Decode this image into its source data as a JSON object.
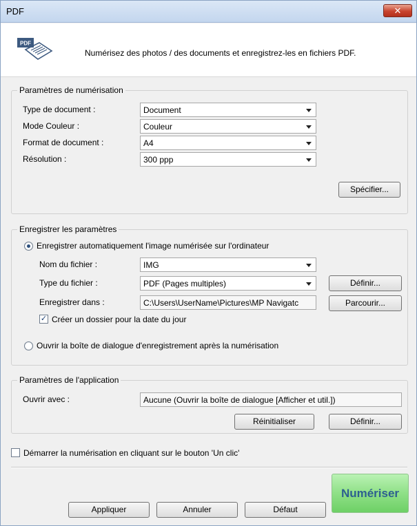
{
  "window": {
    "title": "PDF",
    "close_glyph": "✕"
  },
  "header": {
    "description": "Numérisez des photos / des documents et enregistrez-les en fichiers PDF.",
    "icon": "pdf-document-icon"
  },
  "scan_settings": {
    "legend": "Paramètres de numérisation",
    "doc_type_label": "Type de document :",
    "doc_type_value": "Document",
    "color_mode_label": "Mode Couleur :",
    "color_mode_value": "Couleur",
    "doc_size_label": "Format de document :",
    "doc_size_value": "A4",
    "resolution_label": "Résolution :",
    "resolution_value": "300 ppp",
    "specify_button": "Spécifier..."
  },
  "save_settings": {
    "legend": "Enregistrer les paramètres",
    "auto_save_label": "Enregistrer automatiquement l'image numérisée sur l'ordinateur",
    "auto_save_selected": true,
    "file_name_label": "Nom du fichier :",
    "file_name_value": "IMG",
    "file_type_label": "Type du fichier :",
    "file_type_value": "PDF (Pages multiples)",
    "define_button": "Définir...",
    "save_in_label": "Enregistrer dans :",
    "save_in_value": "C:\\Users\\UserName\\Pictures\\MP Navigatc",
    "browse_button": "Parcourir...",
    "subfolder_label": "Créer un dossier pour la date du jour",
    "subfolder_checked": true,
    "open_dialog_label": "Ouvrir la boîte de dialogue d'enregistrement après la numérisation",
    "open_dialog_selected": false
  },
  "app_settings": {
    "legend": "Paramètres de l'application",
    "open_with_label": "Ouvrir avec :",
    "open_with_value": "Aucune (Ouvrir la boîte de dialogue [Afficher et util.])",
    "reset_button": "Réinitialiser",
    "define_button": "Définir..."
  },
  "one_click": {
    "label": "Démarrer la numérisation en cliquant sur le bouton 'Un clic'",
    "checked": false
  },
  "footer": {
    "apply_button": "Appliquer",
    "cancel_button": "Annuler",
    "default_button": "Défaut",
    "scan_button": "Numériser"
  },
  "colors": {
    "scan_button": "#8fe087",
    "scan_text": "#2d5f8f",
    "title_bar": "#c3d6ee",
    "close_button": "#c8442f"
  }
}
